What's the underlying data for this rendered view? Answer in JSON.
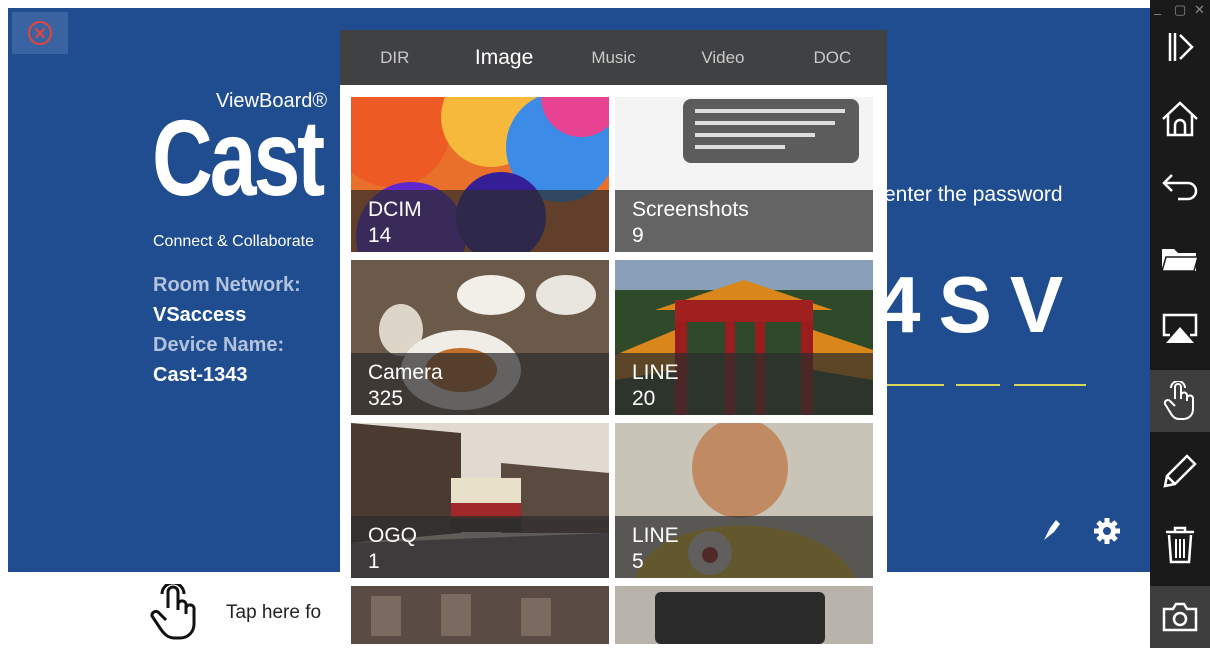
{
  "brand": {
    "product_line": "ViewBoard®",
    "name": "Cast",
    "tagline": "Connect & Collaborate"
  },
  "info": {
    "room_network_label": "Room Network:",
    "room_network_value": "VSaccess",
    "device_name_label": "Device Name:",
    "device_name_value": "Cast-1343"
  },
  "password": {
    "prompt": "enter the password",
    "code": "4SV"
  },
  "bottom": {
    "tap_text": "Tap here fo"
  },
  "picker": {
    "tabs": [
      "DIR",
      "Image",
      "Music",
      "Video",
      "DOC"
    ],
    "selected_tab": "Image",
    "albums": [
      {
        "name": "DCIM",
        "count": "14"
      },
      {
        "name": "Screenshots",
        "count": "9"
      },
      {
        "name": "Camera",
        "count": "325"
      },
      {
        "name": "LINE",
        "count": "20"
      },
      {
        "name": "OGQ",
        "count": "1"
      },
      {
        "name": "LINE",
        "count": "5"
      }
    ]
  },
  "sidebar": {
    "items": [
      "collapse-icon",
      "home-icon",
      "back-icon",
      "folder-icon",
      "airplay-icon",
      "touch-icon",
      "pen-icon",
      "trash-icon",
      "camera-icon"
    ],
    "active": "touch-icon"
  },
  "colors": {
    "background": "#1f4d8f",
    "code_underline": "#d8d55a",
    "sidebar": "#1a1a1a",
    "tab_bar": "#3f4143",
    "close_icon": "#e8433a"
  }
}
